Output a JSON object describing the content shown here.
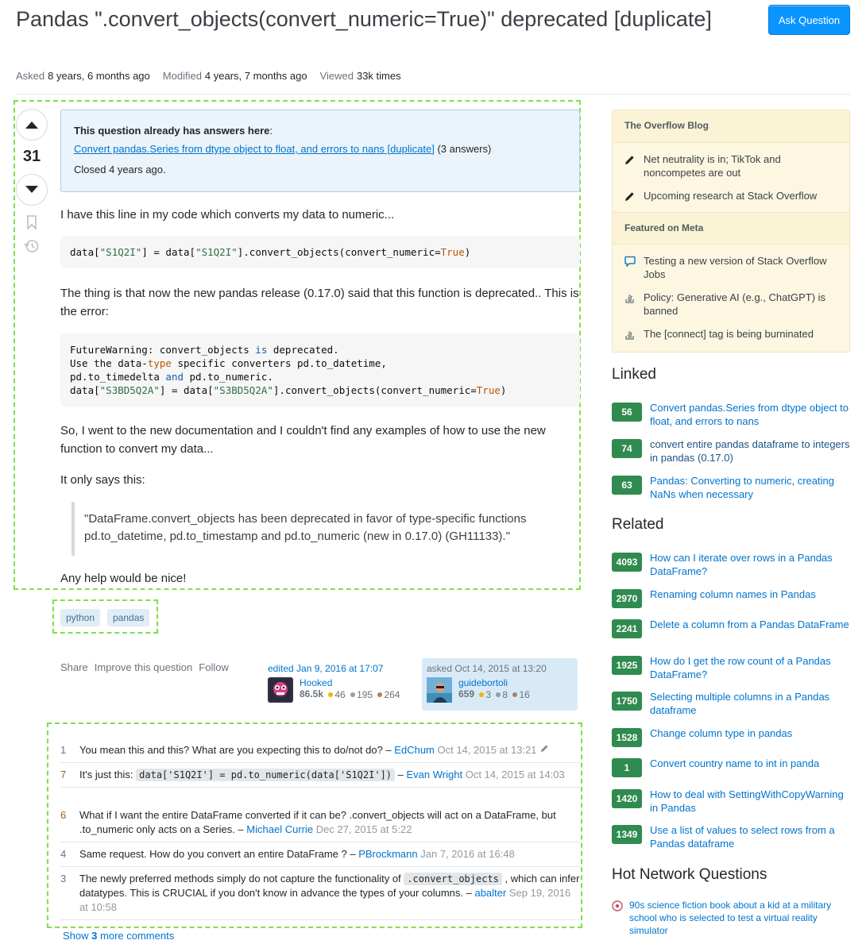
{
  "question": {
    "title": "Pandas \".convert_objects(convert_numeric=True)\" deprecated [duplicate]",
    "ask_button": "Ask Question",
    "meta": [
      {
        "label": "Asked",
        "value": "8 years, 6 months ago"
      },
      {
        "label": "Modified",
        "value": "4 years, 7 months ago"
      },
      {
        "label": "Viewed",
        "value": "33k times"
      }
    ],
    "votes": "31"
  },
  "duplicate_notice": {
    "heading": "This question already has answers here",
    "colon": ":",
    "link": "Convert pandas.Series from dtype object to float, and errors to nans [duplicate]",
    "answers": "(3 answers)",
    "closed": "Closed 4 years ago."
  },
  "body": {
    "p1": "I have this line in my code which converts my data to numeric...",
    "p2": "The thing is that now the new pandas release (0.17.0) said that this function is deprecated.. This is the error:",
    "p3": "So, I went to the new documentation and I couldn't find any examples of how to use the new function to convert my data...",
    "p4": "It only says this:",
    "quote": "\"DataFrame.convert_objects has been deprecated in favor of type-specific functions pd.to_datetime, pd.to_timestamp and pd.to_numeric (new in 0.17.0) (GH11133).\"",
    "p5": "Any help would be nice!"
  },
  "tags": [
    "python",
    "pandas"
  ],
  "post_menu": [
    "Share",
    "Improve this question",
    "Follow"
  ],
  "edited": {
    "when": "edited Jan 9, 2016 at 17:07",
    "user": "Hooked",
    "rep": "86.5k",
    "gold": "46",
    "silver": "195",
    "bronze": "264"
  },
  "asked": {
    "when": "asked Oct 14, 2015 at 13:20",
    "user": "guidebortoli",
    "rep": "659",
    "gold": "3",
    "silver": "8",
    "bronze": "16"
  },
  "comments": [
    {
      "score": "1",
      "text": "You mean this and this? What are you expecting this to do/not do? –",
      "user": "EdChum",
      "date": "Oct 14, 2015 at 13:21"
    },
    {
      "score": "7",
      "pre": "It's just this:",
      "code": "data['S1Q2I'] = pd.to_numeric(data['S1Q2I'])",
      "post": "–",
      "user": "Evan Wright",
      "date": "Oct 14, 2015 at 14:03"
    },
    {
      "score": "6",
      "text": "What if I want the entire DataFrame converted if it can be? .convert_objects will act on a DataFrame, but .to_numeric only acts on a Series. –",
      "user": "Michael Currie",
      "date": "Dec 27, 2015 at 5:22"
    },
    {
      "score": "4",
      "text": "Same request. How do you convert an entire DataFrame ? –",
      "user": "PBrockmann",
      "date": "Jan 7, 2016 at 16:48"
    },
    {
      "score": "3",
      "pre": "The newly preferred methods simply do not capture the functionality of",
      "code": ".convert_objects",
      "post": ", which can infer datatypes. This is CRUCIAL if you don't know in advance the types of your columns. –",
      "user": "abalter",
      "date": "Sep 19, 2016 at 10:58"
    }
  ],
  "show_more": {
    "prefix": "Show",
    "count": "3",
    "suffix": "more comments"
  },
  "sidebar": {
    "blog_header": "The Overflow Blog",
    "blog": [
      "Net neutrality is in; TikTok and noncompetes are out",
      "Upcoming research at Stack Overflow"
    ],
    "meta_header": "Featured on Meta",
    "meta": [
      "Testing a new version of Stack Overflow Jobs",
      "Policy: Generative AI (e.g., ChatGPT) is banned",
      "The [connect] tag is being burninated"
    ],
    "linked_title": "Linked",
    "linked": [
      {
        "count": "56",
        "title": "Convert pandas.Series from dtype object to float, and errors to nans"
      },
      {
        "count": "74",
        "title": "convert entire pandas dataframe to integers in pandas (0.17.0)"
      },
      {
        "count": "63",
        "title": "Pandas: Converting to numeric, creating NaNs when necessary"
      }
    ],
    "related_title": "Related",
    "related": [
      {
        "count": "4093",
        "title": "How can I iterate over rows in a Pandas DataFrame?"
      },
      {
        "count": "2970",
        "title": "Renaming column names in Pandas"
      },
      {
        "count": "2241",
        "title": "Delete a column from a Pandas DataFrame"
      },
      {
        "count": "1925",
        "title": "How do I get the row count of a Pandas DataFrame?"
      },
      {
        "count": "1750",
        "title": "Selecting multiple columns in a Pandas dataframe"
      },
      {
        "count": "1528",
        "title": "Change column type in pandas"
      },
      {
        "count": "1",
        "title": "Convert country name to int in panda"
      },
      {
        "count": "1420",
        "title": "How to deal with SettingWithCopyWarning in Pandas"
      },
      {
        "count": "1349",
        "title": "Use a list of values to select rows from a Pandas dataframe"
      }
    ],
    "hot_title": "Hot Network Questions",
    "hot": [
      "90s science fiction book about a kid at a military school who is selected to test a virtual reality simulator"
    ]
  }
}
